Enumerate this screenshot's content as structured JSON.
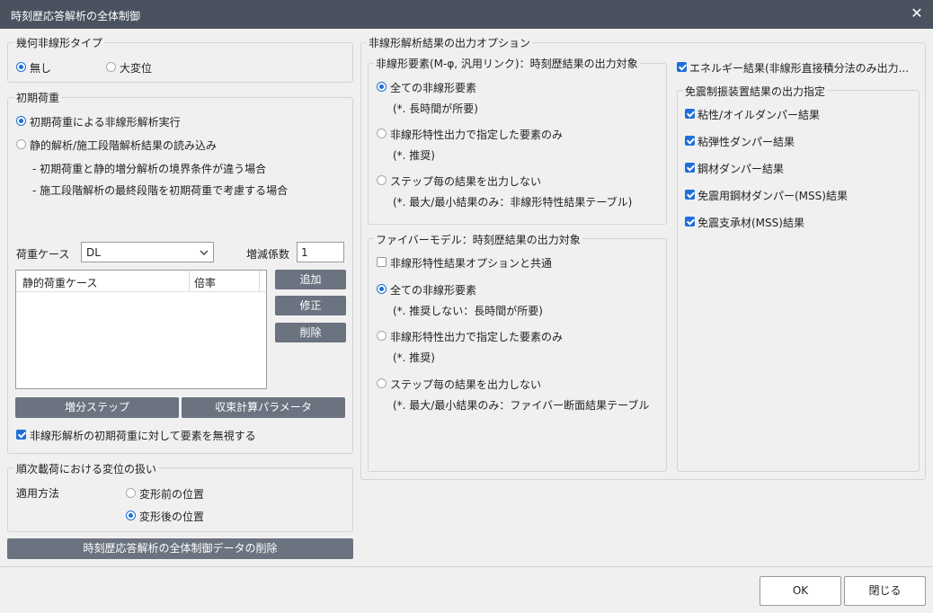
{
  "window": {
    "title": "時刻歴応答解析の全体制御",
    "close_glyph": "✕"
  },
  "geometric_nonlinear": {
    "legend": "幾何非線形タイプ",
    "options": [
      "無し",
      "大変位"
    ],
    "selected": "無し"
  },
  "initial_load": {
    "legend": "初期荷重",
    "opt_nonlinear": "初期荷重による非線形解析実行",
    "opt_static": "静的解析/施工段階解析結果の読み込み",
    "note1": "- 初期荷重と静的増分解析の境界条件が違う場合",
    "note2": "- 施工段階解析の最終段階を初期荷重で考慮する場合",
    "load_case_label": "荷重ケース",
    "load_case_value": "DL",
    "factor_label": "増減係数",
    "factor_value": "1",
    "table_headers": [
      "静的荷重ケース",
      "倍率"
    ],
    "add_button": "追加",
    "modify_button": "修正",
    "delete_button": "削除",
    "increment_button": "増分ステップ",
    "convergence_button": "収束計算パラメータ",
    "ignore_checkbox": "非線形解析の初期荷重に対して要素を無視する"
  },
  "sequential_loading": {
    "legend": "順次載荷における変位の扱い",
    "method_label": "適用方法",
    "opt_before": "変形前の位置",
    "opt_after": "変形後の位置"
  },
  "delete_data_button": "時刻歴応答解析の全体制御データの削除",
  "output_options": {
    "legend": "非線形解析結果の出力オプション",
    "elements": {
      "legend": "非線形要素(M-φ, 汎用リンク)：時刻歴結果の出力対象",
      "opt_all": "全ての非線形要素",
      "opt_all_note": "(*. 長時間が所要)",
      "opt_specified": "非線形特性出力で指定した要素のみ",
      "opt_specified_note": "(*. 推奨)",
      "opt_none": "ステップ毎の結果を出力しない",
      "opt_none_note": "(*. 最大/最小結果のみ：非線形特性結果テーブル)"
    },
    "fiber": {
      "legend": "ファイバーモデル：時刻歴結果の出力対象",
      "common_checkbox": "非線形特性結果オプションと共通",
      "opt_all": "全ての非線形要素",
      "opt_all_note": "(*. 推奨しない：長時間が所要)",
      "opt_specified": "非線形特性出力で指定した要素のみ",
      "opt_specified_note": "(*. 推奨)",
      "opt_none": "ステップ毎の結果を出力しない",
      "opt_none_note": "(*. 最大/最小結果のみ：ファイバー断面結果テーブル"
    },
    "energy_checkbox": "エネルギー結果(非線形直接積分法のみ出力...",
    "isolation": {
      "legend": "免震制振装置結果の出力指定",
      "items": [
        "粘性/オイルダンパー結果",
        "粘弾性ダンパー結果",
        "鋼材ダンパー結果",
        "免震用鋼材ダンパー(MSS)結果",
        "免震支承材(MSS)結果"
      ]
    }
  },
  "footer": {
    "ok": "OK",
    "close": "閉じる"
  },
  "colors": {
    "titlebar": "#4a5260",
    "accent": "#1e6fd9",
    "button_dark": "#6b7280"
  }
}
